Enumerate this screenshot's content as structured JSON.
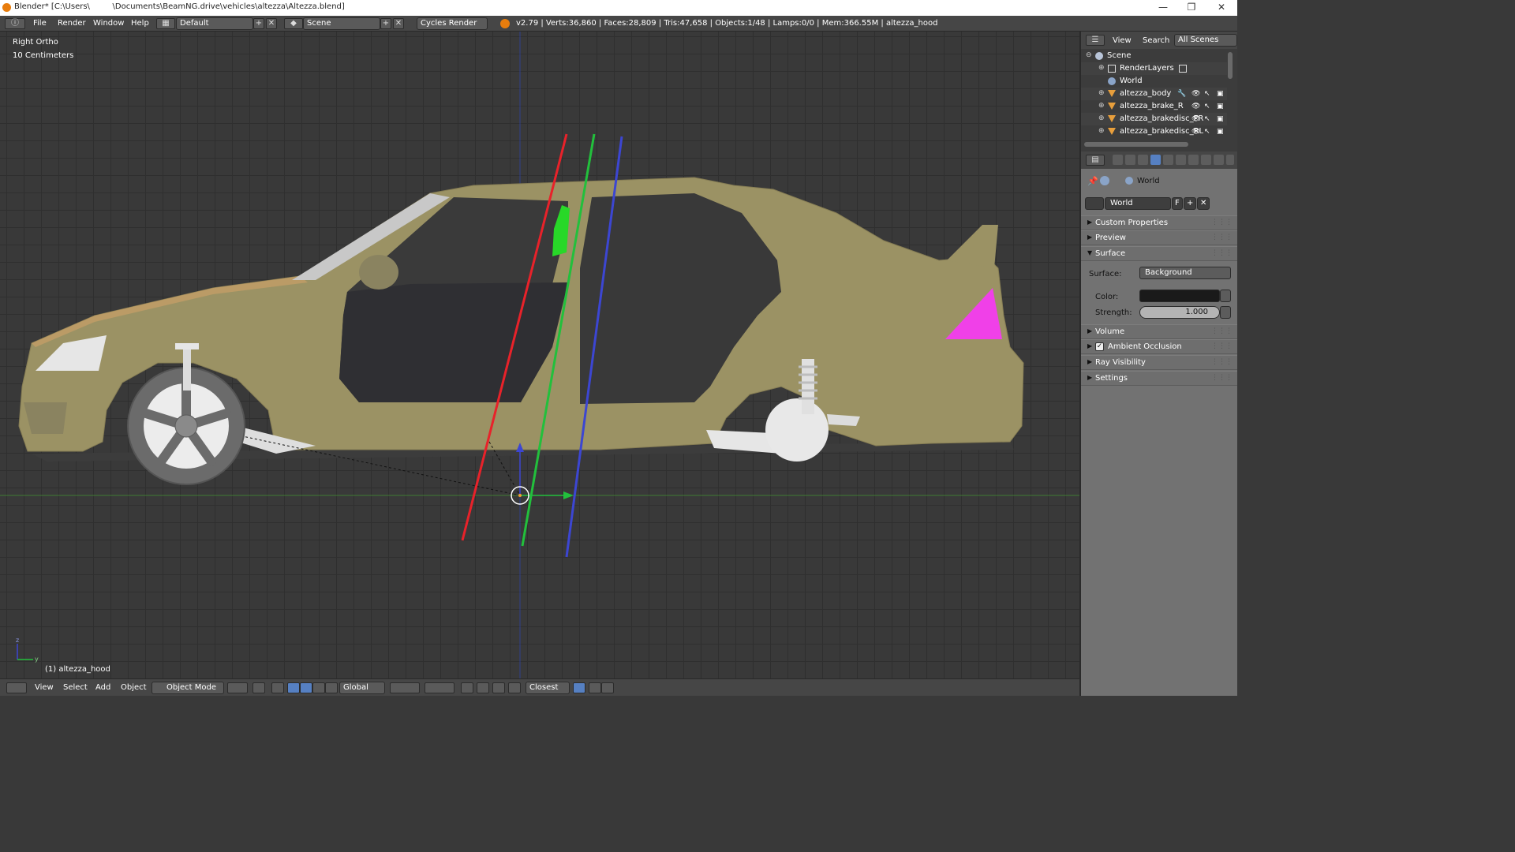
{
  "window": {
    "title": "Blender* [C:\\Users\\         \\Documents\\BeamNG.drive\\vehicles\\altezza\\Altezza.blend]",
    "controls": {
      "minimize": "—",
      "restore": "❐",
      "close": "✕"
    }
  },
  "info_header": {
    "menus": [
      "File",
      "Render",
      "Window",
      "Help"
    ],
    "screen_layout": "Default",
    "scene": "Scene",
    "render_engine": "Cycles Render",
    "stats": "v2.79 | Verts:36,860 | Faces:28,809 | Tris:47,658 | Objects:1/48 | Lamps:0/0 | Mem:366.55M | altezza_hood"
  },
  "viewport": {
    "view_name": "Right Ortho",
    "grid_scale": "10 Centimeters",
    "active_object": "(1) altezza_hood",
    "axis_labels": {
      "y": "y",
      "z": "z"
    }
  },
  "view3d_header": {
    "menus": [
      "View",
      "Select",
      "Add",
      "Object"
    ],
    "mode": "Object Mode",
    "orientation": "Global",
    "snap_target": "Closest"
  },
  "outliner": {
    "header": {
      "view": "View",
      "search": "Search",
      "filter": "All Scenes"
    },
    "items": [
      {
        "label": "Scene",
        "icon": "scene-icon"
      },
      {
        "label": "RenderLayers",
        "icon": "renderlayers-icon"
      },
      {
        "label": "World",
        "icon": "world-icon"
      },
      {
        "label": "altezza_body",
        "icon": "mesh-icon"
      },
      {
        "label": "altezza_brake_R",
        "icon": "mesh-icon"
      },
      {
        "label": "altezza_brakedisc_FR",
        "icon": "mesh-icon"
      },
      {
        "label": "altezza_brakedisc_RL",
        "icon": "mesh-icon"
      }
    ]
  },
  "properties": {
    "breadcrumb": "World",
    "world_datablock": "World",
    "fake_user": "F",
    "panels": {
      "custom_properties": "Custom Properties",
      "preview": "Preview",
      "surface": "Surface",
      "volume": "Volume",
      "ambient_occlusion": "Ambient Occlusion",
      "ray_visibility": "Ray Visibility",
      "settings": "Settings"
    },
    "surface": {
      "surface_label": "Surface:",
      "surface_value": "Background",
      "color_label": "Color:",
      "color_value": "#1a1a1a",
      "strength_label": "Strength:",
      "strength_value": "1.000"
    }
  },
  "colors": {
    "car_body": "#9b9264",
    "x_axis": "#e8222a",
    "y_axis": "#22c03c",
    "z_axis": "#3c46d2",
    "active_tab": "#5680c2"
  }
}
